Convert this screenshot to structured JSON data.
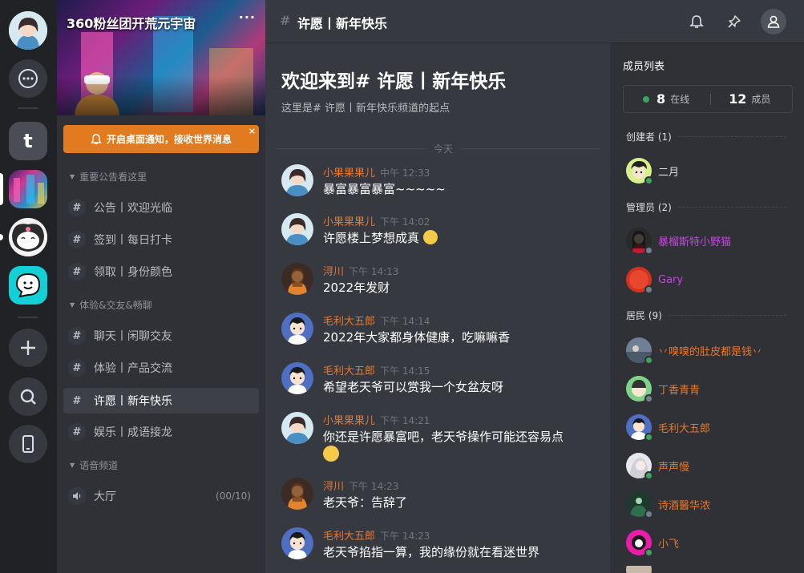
{
  "server": {
    "name": "360粉丝团开荒元宇宙",
    "more": "···",
    "notice": "开启桌面通知，接收世界消息",
    "notice_close": "×"
  },
  "rail": {
    "letter_server": "t"
  },
  "categories": [
    {
      "label": "重要公告看这里"
    },
    {
      "label": "体验&交友&畅聊"
    },
    {
      "label": "语音频道"
    }
  ],
  "channels": [
    {
      "label": "公告丨欢迎光临"
    },
    {
      "label": "签到丨每日打卡"
    },
    {
      "label": "领取丨身份颜色"
    },
    {
      "label": "聊天丨闲聊交友"
    },
    {
      "label": "体验丨产品交流"
    },
    {
      "label": "许愿丨新年快乐"
    },
    {
      "label": "娱乐丨成语接龙"
    },
    {
      "label": "大厅",
      "count": "(00/10)"
    }
  ],
  "header": {
    "hash": "#",
    "title": "许愿丨新年快乐"
  },
  "welcome": {
    "title": "欢迎来到# 许愿丨新年快乐",
    "subtitle": "这里是# 许愿丨新年快乐频道的起点",
    "divider": "今天"
  },
  "messages": [
    {
      "user": "小果果果儿",
      "time": "中午 12:33",
      "text": "暴富暴富暴富~~~~~"
    },
    {
      "user": "小果果果儿",
      "time": "下午 14:02",
      "text": "许愿楼上梦想成真"
    },
    {
      "user": "浔川",
      "time": "下午 14:13",
      "text": "2022年发财"
    },
    {
      "user": "毛利大五郎",
      "time": "下午 14:14",
      "text": "2022年大家都身体健康，吃嘛嘛香"
    },
    {
      "user": "毛利大五郎",
      "time": "下午 14:15",
      "text": "希望老天爷可以赏我一个女盆友呀"
    },
    {
      "user": "小果果果儿",
      "time": "下午 14:21",
      "text": "你还是许愿暴富吧，老天爷操作可能还容易点"
    },
    {
      "user": "浔川",
      "time": "下午 14:23",
      "text": "老天爷：告辞了"
    },
    {
      "user": "毛利大五郎",
      "time": "下午 14:23",
      "text": "老天爷掐指一算，我的缘份就在看迷世界"
    }
  ],
  "members": {
    "title": "成员列表",
    "online_count": "8",
    "online_label": "在线",
    "member_count": "12",
    "member_label": "成员",
    "groups": [
      {
        "label": "创建者 (1)"
      },
      {
        "label": "管理员 (2)"
      },
      {
        "label": "居民 (9)"
      }
    ],
    "list": [
      {
        "name": "二月",
        "color": "#dcddde",
        "status": "online"
      },
      {
        "name": "暴榴斯特小野猫",
        "color": "#c04bd8",
        "status": "offline"
      },
      {
        "name": "Gary",
        "color": "#c04bd8",
        "status": "offline"
      },
      {
        "name": "丷嗅嗅的肚皮都是钱丷",
        "color": "#e8772e",
        "status": "online"
      },
      {
        "name": "丁香青青",
        "color": "#e8772e",
        "status": "offline"
      },
      {
        "name": "毛利大五郎",
        "color": "#e8772e",
        "status": "online"
      },
      {
        "name": "声声慢",
        "color": "#e8772e",
        "status": "online"
      },
      {
        "name": "诗酒醫华浓",
        "color": "#e8772e",
        "status": "offline"
      },
      {
        "name": "小飞",
        "color": "#e8772e",
        "status": "online"
      }
    ]
  },
  "colors": {
    "accent": "#e8772e",
    "online": "#3ba55d",
    "offline": "#747f8d",
    "admin": "#c04bd8"
  }
}
